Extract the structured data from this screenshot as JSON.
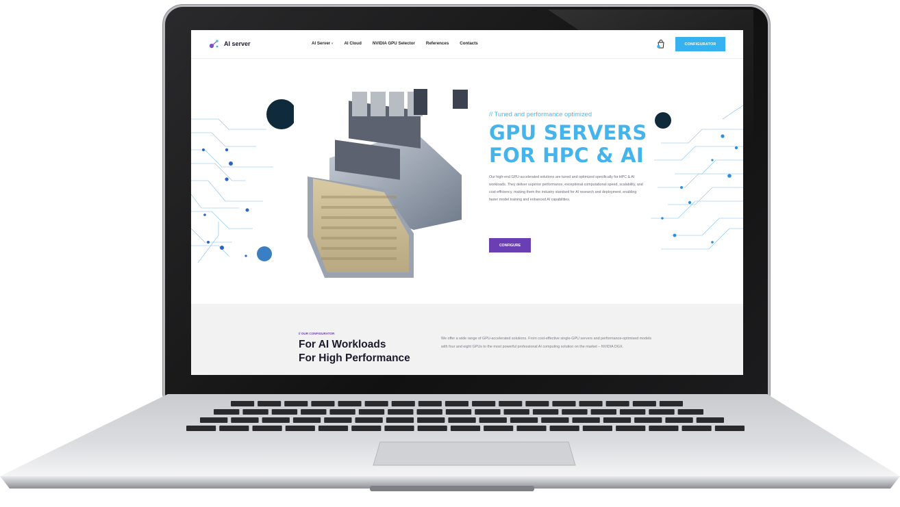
{
  "header": {
    "logo_text": "AI server",
    "nav": [
      "AI Server",
      "AI Cloud",
      "NVIDIA GPU Selector",
      "References",
      "Contacts"
    ],
    "configurator_label": "CONFIGURATOR"
  },
  "hero": {
    "tagline": "// Tuned and performance optimized",
    "title_line1": "GPU SERVERS",
    "title_line2": "FOR HPC & AI",
    "description": "Our high-end GPU-accelerated solutions are tuned and optimized specifically for HPC & AI workloads. They deliver superior performance, exceptional computational speed, scalability, and cost-efficiency, making them the industry standard for AI research and deployment, enabling faster model training and enhanced AI capabilities.",
    "button_label": "CONFIGURE"
  },
  "configurator": {
    "eyebrow": "// OUR CONFIGURATOR",
    "title_line1": "For AI Workloads",
    "title_line2": "For High Performance",
    "description": "We offer a wide range of GPU-accelerated solutions. From cost-effective single-GPU servers and performance-optimised models with four and eight GPUs to the most powerful professional AI computing solution on the market – NVIDIA DGX."
  },
  "colors": {
    "accent_blue": "#45b4ec",
    "accent_purple": "#6a3fb4",
    "button_blue": "#36b2f0"
  },
  "icons": [
    "logo-mark-icon",
    "chevron-down-icon",
    "cart-icon"
  ]
}
